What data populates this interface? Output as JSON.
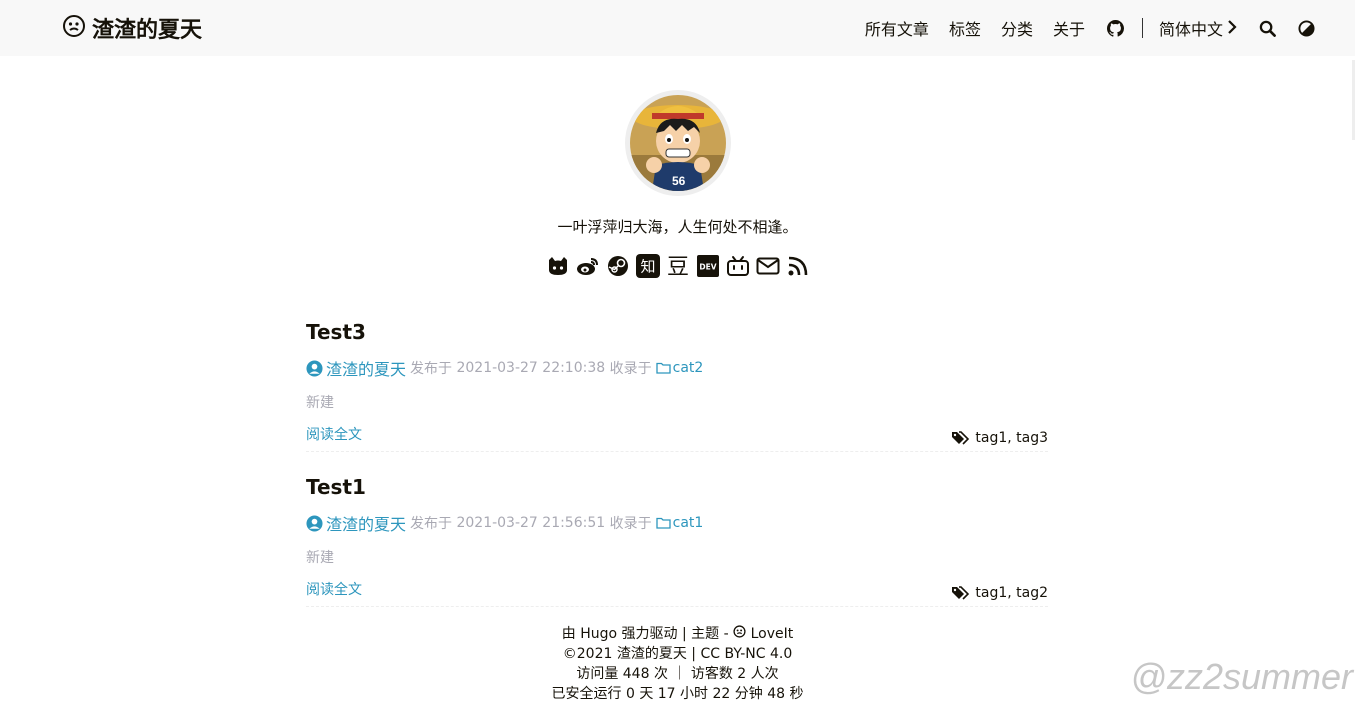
{
  "header": {
    "site_title": "渣渣的夏天",
    "menu": [
      "所有文章",
      "标签",
      "分类",
      "关于"
    ],
    "language": "简体中文"
  },
  "profile": {
    "subtitle": "一叶浮萍归大海，人生何处不相逢。",
    "social_icons": [
      "github-icon",
      "weibo-icon",
      "steam-icon",
      "zhihu-icon",
      "douban-icon",
      "dev-icon",
      "bilibili-icon",
      "email-icon",
      "rss-icon"
    ],
    "zhihu_label": "知",
    "douban_label": "豆",
    "dev_label": "DEV"
  },
  "posts": [
    {
      "title": "Test3",
      "author": "渣渣的夏天",
      "published_label": "发布于",
      "date": "2021-03-27 22:10:38",
      "collected_label": "收录于",
      "category": "cat2",
      "summary": "新建",
      "read_more": "阅读全文",
      "tags": "tag1, tag3"
    },
    {
      "title": "Test1",
      "author": "渣渣的夏天",
      "published_label": "发布于",
      "date": "2021-03-27 21:56:51",
      "collected_label": "收录于",
      "category": "cat1",
      "summary": "新建",
      "read_more": "阅读全文",
      "tags": "tag1, tag2"
    }
  ],
  "footer": {
    "powered_prefix": "由",
    "hugo": "Hugo",
    "powered_suffix": "强力驱动 | 主题 -",
    "theme": "LoveIt",
    "copyright_year": "©2021",
    "copyright_owner": "渣渣的夏天",
    "license": "CC BY-NC 4.0",
    "stats": "访问量 448 次 ｜ 访客数 2 人次",
    "uptime": "已安全运行 0 天 17 小时 22 分钟 48 秒"
  },
  "watermark": "@zz2summer",
  "colors": {
    "accent": "#2d96bd",
    "meta_gray": "#a9a9b3",
    "header_bg": "#f8f8f8"
  }
}
